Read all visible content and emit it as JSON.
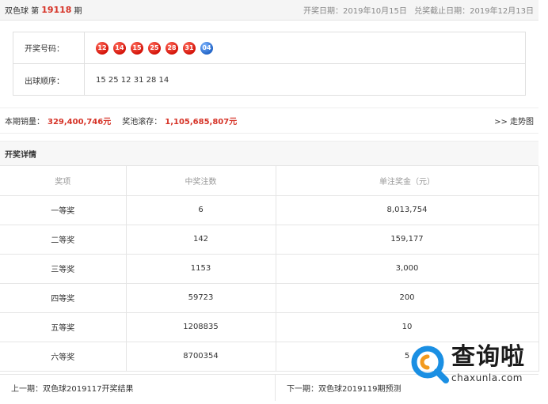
{
  "header": {
    "lottery_name": "双色球 第",
    "issue": "19118",
    "issue_suffix": "期",
    "draw_date": "开奖日期：2019年10月15日",
    "redeem_deadline": "兑奖截止日期：2019年12月13日"
  },
  "numbers": {
    "winning_label": "开奖号码：",
    "red_balls": [
      "12",
      "14",
      "15",
      "25",
      "28",
      "31"
    ],
    "blue_ball": "04",
    "order_label": "出球顺序：",
    "order_value": "15 25 12 31 28 14"
  },
  "sales": {
    "sales_label": "本期销量：",
    "sales_value": "329,400,746元",
    "pool_label": "奖池滚存：",
    "pool_value": "1,105,685,807元",
    "trend_link": ">> 走势图"
  },
  "details": {
    "title": "开奖详情",
    "headers": [
      "奖项",
      "中奖注数",
      "单注奖金（元）"
    ],
    "rows": [
      {
        "prize": "一等奖",
        "count": "6",
        "amount": "8,013,754"
      },
      {
        "prize": "二等奖",
        "count": "142",
        "amount": "159,177"
      },
      {
        "prize": "三等奖",
        "count": "1153",
        "amount": "3,000"
      },
      {
        "prize": "四等奖",
        "count": "59723",
        "amount": "200"
      },
      {
        "prize": "五等奖",
        "count": "1208835",
        "amount": "10"
      },
      {
        "prize": "六等奖",
        "count": "8700354",
        "amount": "5"
      }
    ]
  },
  "footer": {
    "prev": "上一期：双色球2019117开奖结果",
    "next": "下一期：双色球2019119期预测"
  },
  "watermark": {
    "cn": "查询啦",
    "en": "chaxunla.com",
    "colors": {
      "blue": "#1a8fe3",
      "orange": "#f29a1f"
    }
  },
  "colors": {
    "accent_red": "#d63327",
    "blue_ball": "#2466c8",
    "red_ball": "#d4140a"
  }
}
